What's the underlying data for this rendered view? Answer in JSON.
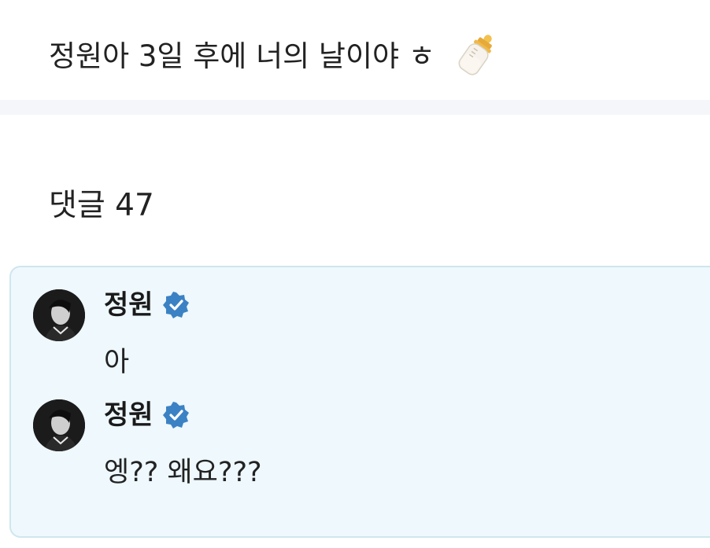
{
  "post": {
    "title": "정원아 3일 후에 너의 날이야 ㅎ",
    "emoji_icon": "baby-bottle-icon"
  },
  "comments_section": {
    "heading": "댓글 47"
  },
  "comments": [
    {
      "author": "정원",
      "verified_icon": "verified-badge-icon",
      "text": "아"
    },
    {
      "author": "정원",
      "verified_icon": "verified-badge-icon",
      "text": "엥?? 왜요???"
    }
  ],
  "colors": {
    "verified_blue": "#3b82c4",
    "thread_background": "#eef8fd",
    "thread_border": "#cfe6ee",
    "divider": "#f4f6f9"
  }
}
